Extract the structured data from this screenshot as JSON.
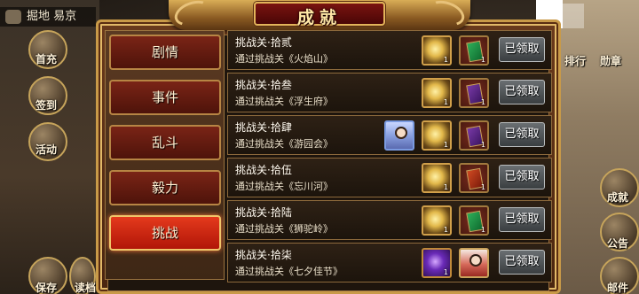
{
  "window": {
    "title": "成就"
  },
  "location": {
    "label": "掘地 易京"
  },
  "side_left": [
    {
      "label": "首充",
      "icon": "gift-icon"
    },
    {
      "label": "签到",
      "icon": "calendar-icon"
    },
    {
      "label": "活动",
      "icon": "flag-icon"
    },
    {
      "label": "保存",
      "icon": "save-icon"
    },
    {
      "label": "读档",
      "icon": "load-icon"
    }
  ],
  "side_right": [
    {
      "label": "排行",
      "icon": "ranking-icon"
    },
    {
      "label": "勋章",
      "icon": "medal-icon"
    },
    {
      "label": "成就",
      "icon": "achievement-icon"
    },
    {
      "label": "公告",
      "icon": "notice-icon"
    },
    {
      "label": "邮件",
      "icon": "mail-icon"
    }
  ],
  "tabs": [
    {
      "label": "剧情",
      "active": false
    },
    {
      "label": "事件",
      "active": false
    },
    {
      "label": "乱斗",
      "active": false
    },
    {
      "label": "毅力",
      "active": false
    },
    {
      "label": "挑战",
      "active": true
    }
  ],
  "achievements": [
    {
      "title": "挑战关·拾贰",
      "desc": "通过挑战关《火焰山》",
      "rewards": [
        {
          "icon": "gold-ingot-icon",
          "qty": "1"
        },
        {
          "icon": "green-book-icon",
          "qty": "1"
        }
      ],
      "button": "已领取"
    },
    {
      "title": "挑战关·拾叁",
      "desc": "通过挑战关《浮生府》",
      "rewards": [
        {
          "icon": "gold-ingot-icon",
          "qty": "1"
        },
        {
          "icon": "purple-book-icon",
          "qty": "1"
        }
      ],
      "button": "已领取"
    },
    {
      "title": "挑战关·拾肆",
      "desc": "通过挑战关《游园会》",
      "rewards": [
        {
          "icon": "hero-portrait-icon",
          "qty": ""
        },
        {
          "icon": "gold-ingot-icon",
          "qty": "1"
        },
        {
          "icon": "purple-book-icon",
          "qty": "1"
        }
      ],
      "button": "已领取"
    },
    {
      "title": "挑战关·拾伍",
      "desc": "通过挑战关《忘川河》",
      "rewards": [
        {
          "icon": "gold-ingot-icon",
          "qty": "1"
        },
        {
          "icon": "red-book-icon",
          "qty": "1"
        }
      ],
      "button": "已领取"
    },
    {
      "title": "挑战关·拾陆",
      "desc": "通过挑战关《狮驼岭》",
      "rewards": [
        {
          "icon": "gold-ingot-icon",
          "qty": "1"
        },
        {
          "icon": "green-book-icon",
          "qty": "1"
        }
      ],
      "button": "已领取"
    },
    {
      "title": "挑战关·拾柒",
      "desc": "通过挑战关《七夕佳节》",
      "rewards": [
        {
          "icon": "purple-gem-icon",
          "qty": "1"
        },
        {
          "icon": "hero-portrait-icon",
          "qty": ""
        }
      ],
      "button": "已领取"
    }
  ],
  "colors": {
    "accent": "#e43a1c",
    "gold": "#e3b45a",
    "panel": "#4a2510"
  }
}
